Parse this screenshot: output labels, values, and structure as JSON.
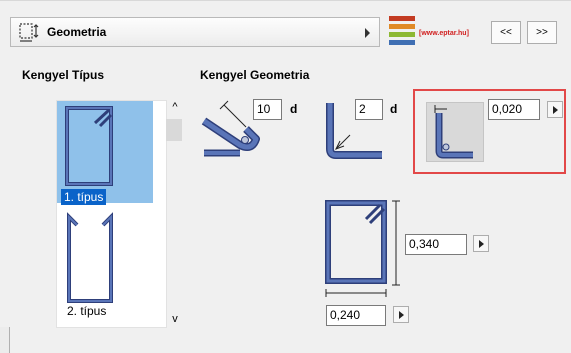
{
  "header": {
    "title": "Geometria",
    "icon": "stirrup-geometry-icon"
  },
  "logo": {
    "text": "[www.eptar.hu]"
  },
  "nav": {
    "prev_label": "<<",
    "next_label": ">>"
  },
  "left_section": {
    "title": "Kengyel Típus"
  },
  "right_section": {
    "title": "Kengyel Geometria"
  },
  "type_list": {
    "items": [
      {
        "label": "1. típus",
        "selected": true
      },
      {
        "label": "2. típus",
        "selected": false
      }
    ],
    "scroll_up": "^",
    "scroll_down": "v"
  },
  "geometry": {
    "hook_length": {
      "value": "10",
      "unit": "d"
    },
    "bend_radius": {
      "value": "2",
      "unit": "d"
    },
    "cover": {
      "value": "0,020"
    },
    "height": {
      "value": "0,340"
    },
    "width": {
      "value": "0,240"
    }
  },
  "colors": {
    "rebar_fill": "#5a75b8",
    "rebar_stroke": "#2e3f7a",
    "selection": "#0a63c9",
    "highlight": "#e24848"
  }
}
